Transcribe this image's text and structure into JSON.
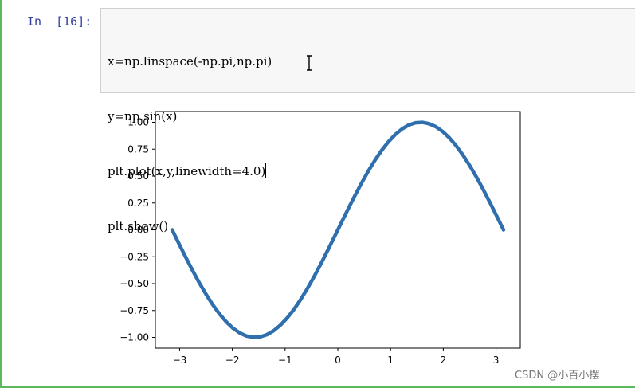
{
  "cell": {
    "prompt": "In  [16]:",
    "code_lines": [
      "x=np.linspace(-np.pi,np.pi)",
      "y=np.sin(x)",
      "plt.plot(x,y,linewidth=4.0)",
      "plt.show()"
    ]
  },
  "colors": {
    "prompt": "#303f9f",
    "cell_border": "#5cb85c",
    "line": "#2f6fad",
    "input_bg": "#f7f7f7"
  },
  "chart_data": {
    "type": "line",
    "series": [
      {
        "function": "sin",
        "x_start": -3.14159,
        "x_end": 3.14159,
        "samples": 50
      }
    ],
    "xlim": [
      -3.46,
      3.46
    ],
    "ylim": [
      -1.1,
      1.1
    ],
    "xticks": [
      -3,
      -2,
      -1,
      0,
      1,
      2,
      3
    ],
    "xtick_labels": [
      "−3",
      "−2",
      "−1",
      "0",
      "1",
      "2",
      "3"
    ],
    "yticks": [
      1.0,
      0.75,
      0.5,
      0.25,
      0.0,
      -0.25,
      -0.5,
      -0.75,
      -1.0
    ],
    "ytick_labels": [
      "1.00",
      "0.75",
      "0.50",
      "0.25",
      "0.00",
      "−0.25",
      "−0.50",
      "−0.75",
      "−1.00"
    ],
    "title": "",
    "xlabel": "",
    "ylabel": "",
    "grid": false,
    "legend": false
  },
  "watermark": "CSDN @小百小摆"
}
